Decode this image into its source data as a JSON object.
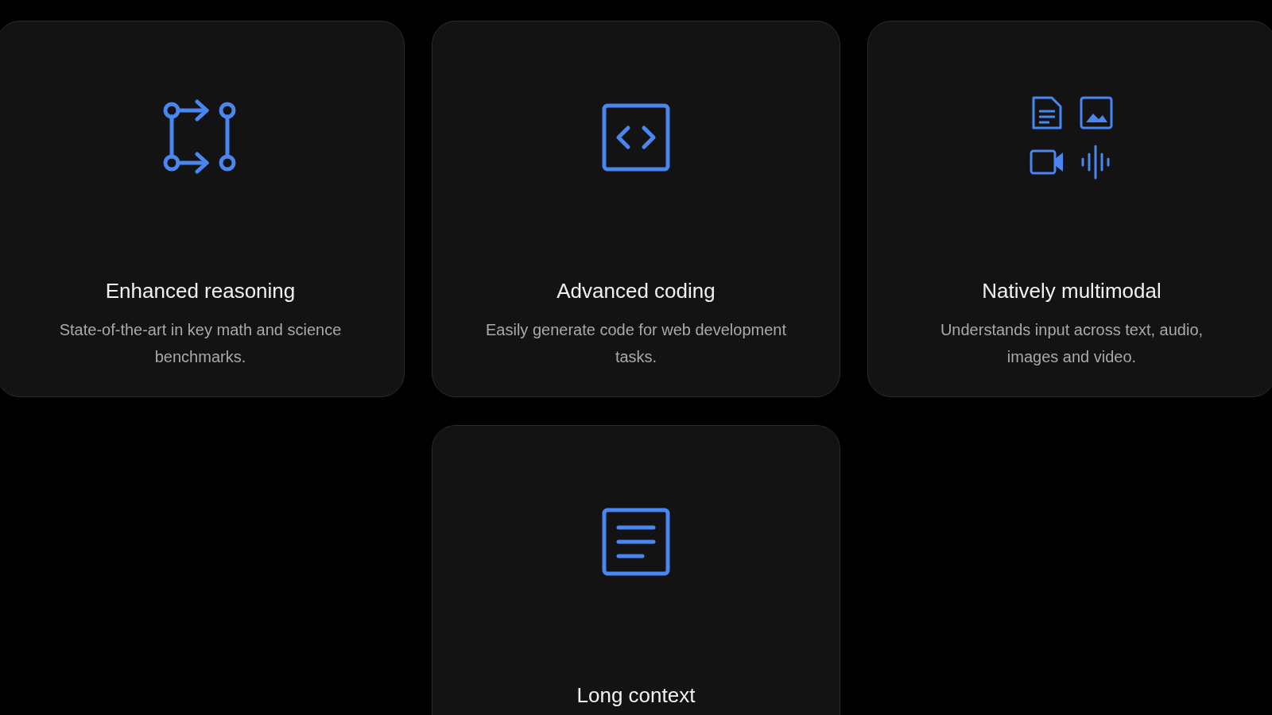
{
  "cards": [
    {
      "kind": "branches",
      "title": "Enhanced reasoning",
      "description": "State-of-the-art in key math and science benchmarks."
    },
    {
      "kind": "code",
      "title": "Advanced coding",
      "description": "Easily generate code for web development tasks."
    },
    {
      "kind": "multimodal",
      "title": "Natively multimodal",
      "description": "Understands input across text, audio, images and video."
    },
    {
      "kind": "document",
      "title": "Long context"
    }
  ]
}
